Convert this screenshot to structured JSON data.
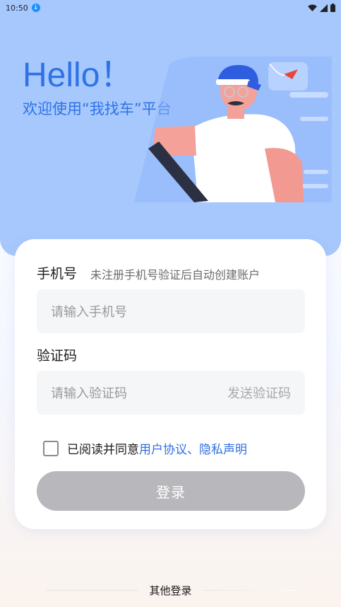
{
  "status_bar": {
    "time": "10:50",
    "download_icon": "download-icon",
    "icons": [
      "wifi-icon",
      "signal-icon",
      "battery-icon"
    ]
  },
  "hero": {
    "greeting": "Hello！",
    "welcome": "欢迎使用“我找车”平台",
    "illustration": "driver-illustration"
  },
  "form": {
    "phone_label": "手机号",
    "phone_hint": "未注册手机号验证后自动创建账户",
    "phone_placeholder": "请输入手机号",
    "code_label": "验证码",
    "code_placeholder": "请输入验证码",
    "send_code": "发送验证码",
    "agree_prefix": "已阅读并同意",
    "agree_links": "用户协议、隐私声明",
    "agree_checked": false,
    "login_button": "登录"
  },
  "footer": {
    "other_login": "其他登录"
  },
  "colors": {
    "hero_bg": "#a6c8fd",
    "accent": "#2f72e6",
    "link": "#2f6fe0",
    "button_disabled": "#b8b8bc",
    "input_bg": "#f5f6f8"
  }
}
